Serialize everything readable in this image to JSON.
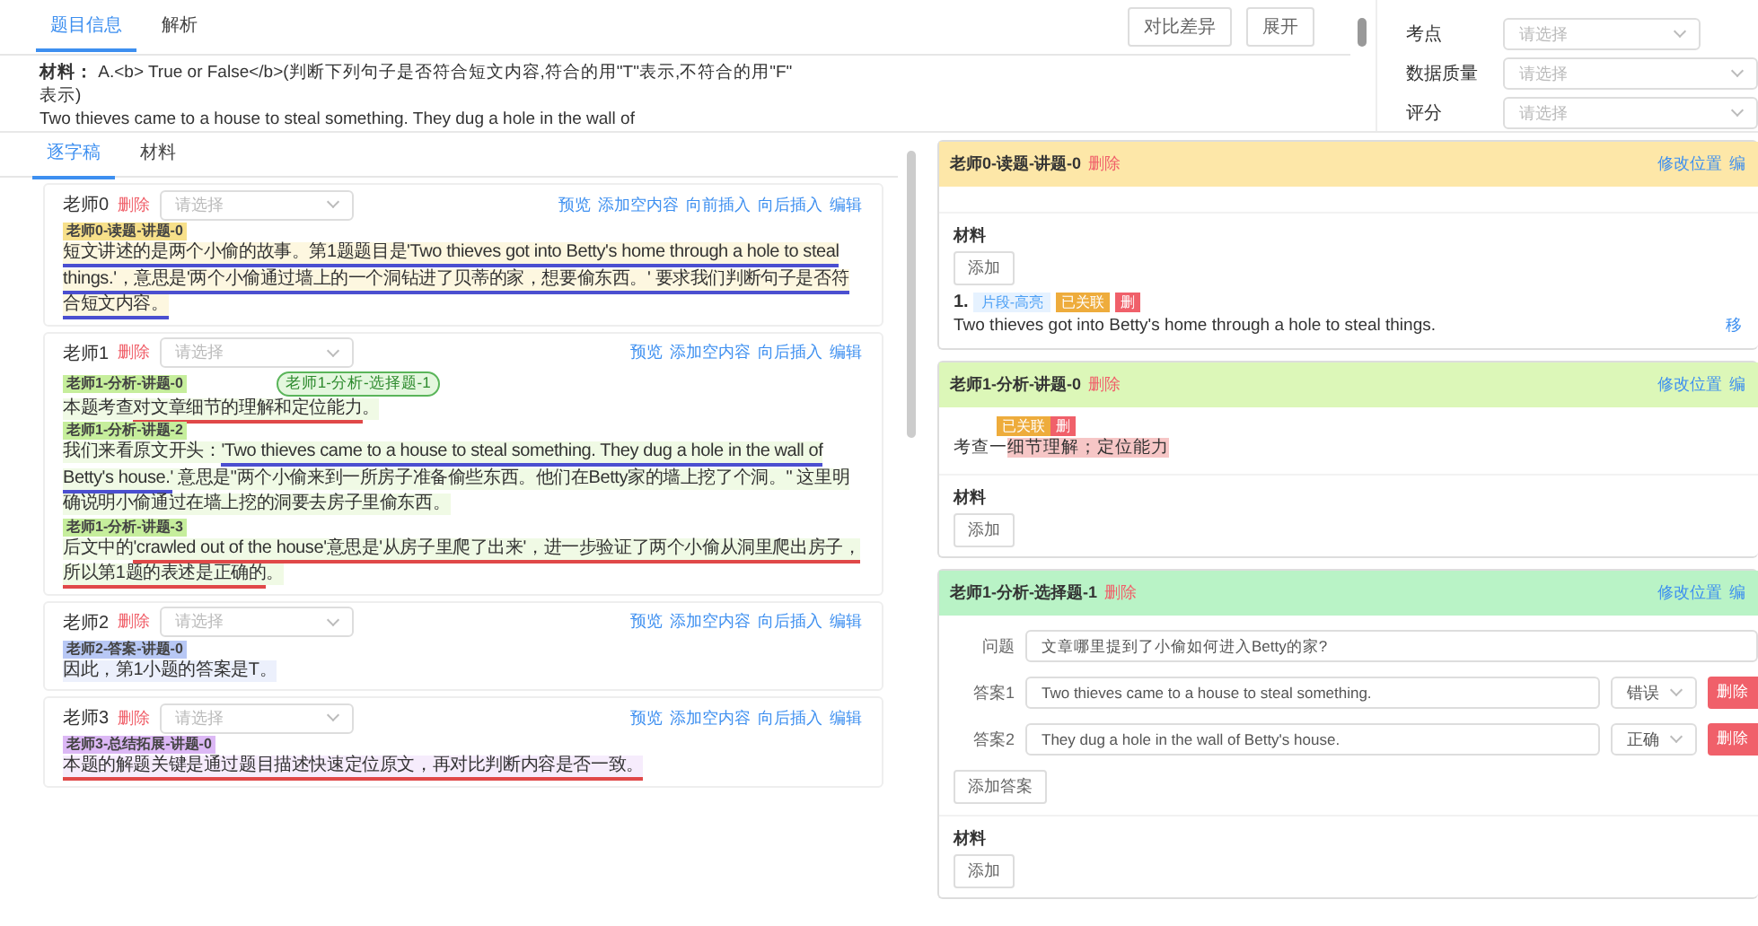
{
  "top_tabs": [
    {
      "label": "题目信息",
      "selected": true
    },
    {
      "label": "解析",
      "selected": false
    }
  ],
  "material": {
    "label": "材料：",
    "lines": [
      "A.<b> True or False</b>(判断下列句子是否符合短文内容,符合的用\"T\"表示,不符合的用\"F\"",
      "表示)",
      "Two thieves came to a house to steal something. They dug a hole in the wall of"
    ]
  },
  "toolbar_buttons": [
    "对比差异",
    "展开"
  ],
  "filters": [
    {
      "label": "考点",
      "placeholder": "请选择"
    },
    {
      "label": "数据质量",
      "placeholder": "请选择"
    },
    {
      "label": "评分",
      "placeholder": "请选择"
    }
  ],
  "left_tabs": [
    {
      "label": "逐字稿",
      "selected": true
    },
    {
      "label": "材料",
      "selected": false
    }
  ],
  "teachers": [
    {
      "name": "老师0",
      "delete": "删除",
      "placeholder": "请选择",
      "color": "#f7e08a",
      "actions": [
        "预览",
        "添加空内容",
        "向前插入",
        "向后插入",
        "编辑"
      ],
      "segments": [
        {
          "tag": "老师0-读题-讲题-0",
          "parts": [
            {
              "text": "短文讲述的是两个小偷的故事。第1题题目是'Two thieves got into Betty's home through a hole to steal things.'，意思是'两个小偷通过墙上的一个洞钻进了贝蒂的家，想要偷东西。' 要求我们判断句子是否符合短文内容。",
              "underline": true,
              "color": "#4b4fd0"
            }
          ]
        }
      ]
    },
    {
      "name": "老师1",
      "delete": "删除",
      "placeholder": "请选择",
      "color": "#c6ee9c",
      "actions": [
        "预览",
        "添加空内容",
        "向后插入",
        "编辑"
      ],
      "segments": [
        {
          "tag": "老师1-分析-讲题-0",
          "pill": "老师1-分析-选择题-1",
          "parts": [
            {
              "text": "本题考查"
            },
            {
              "text": "对文章细节的理解和定位能力",
              "underline": true,
              "color": "#e04848"
            },
            {
              "text": "。"
            }
          ]
        },
        {
          "tag": "老师1-分析-讲题-2",
          "parts": [
            {
              "text": "我们来看原文开头："
            },
            {
              "text": "'Two thieves came to a house to steal something. They dug a hole in the wall of Betty's house.'",
              "underline": true,
              "color": "#4b4fd0"
            },
            {
              "text": " 意思是\"两个小偷来到一所房子准备偷些东西。他们在Betty家的墙上挖了个洞。\" 这里明确说明小偷通过在墙上挖的洞要去房子里偷东西。"
            }
          ]
        },
        {
          "tag": "老师1-分析-讲题-3",
          "parts": [
            {
              "text": "后文中的"
            },
            {
              "text": "'crawled out of the house'意思是'从房子里爬了出来'，进一步验证了两个小偷从洞里爬出房子，所以第1题的表述是正确的",
              "underline": true,
              "color": "#e04848"
            },
            {
              "text": "。"
            }
          ]
        }
      ]
    },
    {
      "name": "老师2",
      "delete": "删除",
      "placeholder": "请选择",
      "color": "#b8c8f5",
      "actions": [
        "预览",
        "添加空内容",
        "向后插入",
        "编辑"
      ],
      "segments": [
        {
          "tag": "老师2-答案-讲题-0",
          "parts": [
            {
              "text": "因此，第1小题的答案是T。"
            }
          ]
        }
      ]
    },
    {
      "name": "老师3",
      "delete": "删除",
      "placeholder": "请选择",
      "color": "#dcb8f5",
      "actions": [
        "预览",
        "添加空内容",
        "向后插入",
        "编辑"
      ],
      "segments": [
        {
          "tag": "老师3-总结拓展-讲题-0",
          "parts": [
            {
              "text": "本题的解题关键是通过题目描述快速定位原文，再对比判断内容是否一致。",
              "underline": true,
              "color": "#e04848"
            }
          ]
        }
      ]
    }
  ],
  "blocks": [
    {
      "kind": "explain",
      "title": "老师0-读题-讲题-0",
      "delete": "删除",
      "color": "#fde7a8",
      "links": [
        "修改位置",
        "编"
      ],
      "material_label": "材料",
      "add_button": "添加",
      "items": [
        {
          "number": "1.",
          "tag": "片段-高亮",
          "badge": "已关联",
          "badge_delete": "删",
          "text": "Two thieves got into Betty's home through a hole to steal things.",
          "link": "移"
        }
      ]
    },
    {
      "kind": "explain",
      "title": "老师1-分析-讲题-0",
      "delete": "删除",
      "color": "#dcf7b8",
      "links": [
        "修改位置",
        "编"
      ],
      "note": {
        "prefix": "考查一",
        "badge": "已关联",
        "badge_delete": "删",
        "highlight": "细节理解；定位能力"
      },
      "material_label": "材料",
      "add_button": "添加"
    },
    {
      "kind": "choice",
      "title": "老师1-分析-选择题-1",
      "delete": "删除",
      "color": "#b9f3c6",
      "links": [
        "修改位置",
        "编"
      ],
      "question": {
        "label": "问题",
        "value": "文章哪里提到了小偷如何进入Betty的家?"
      },
      "answers": [
        {
          "label": "答案1",
          "value": "Two thieves came to a house to steal something.",
          "verdict": "错误",
          "delete": "删除"
        },
        {
          "label": "答案2",
          "value": "They dug a hole in the wall of Betty's house.",
          "verdict": "正确",
          "delete": "删除"
        }
      ],
      "add_answer": "添加答案",
      "material_label": "材料",
      "add_button": "添加"
    }
  ]
}
